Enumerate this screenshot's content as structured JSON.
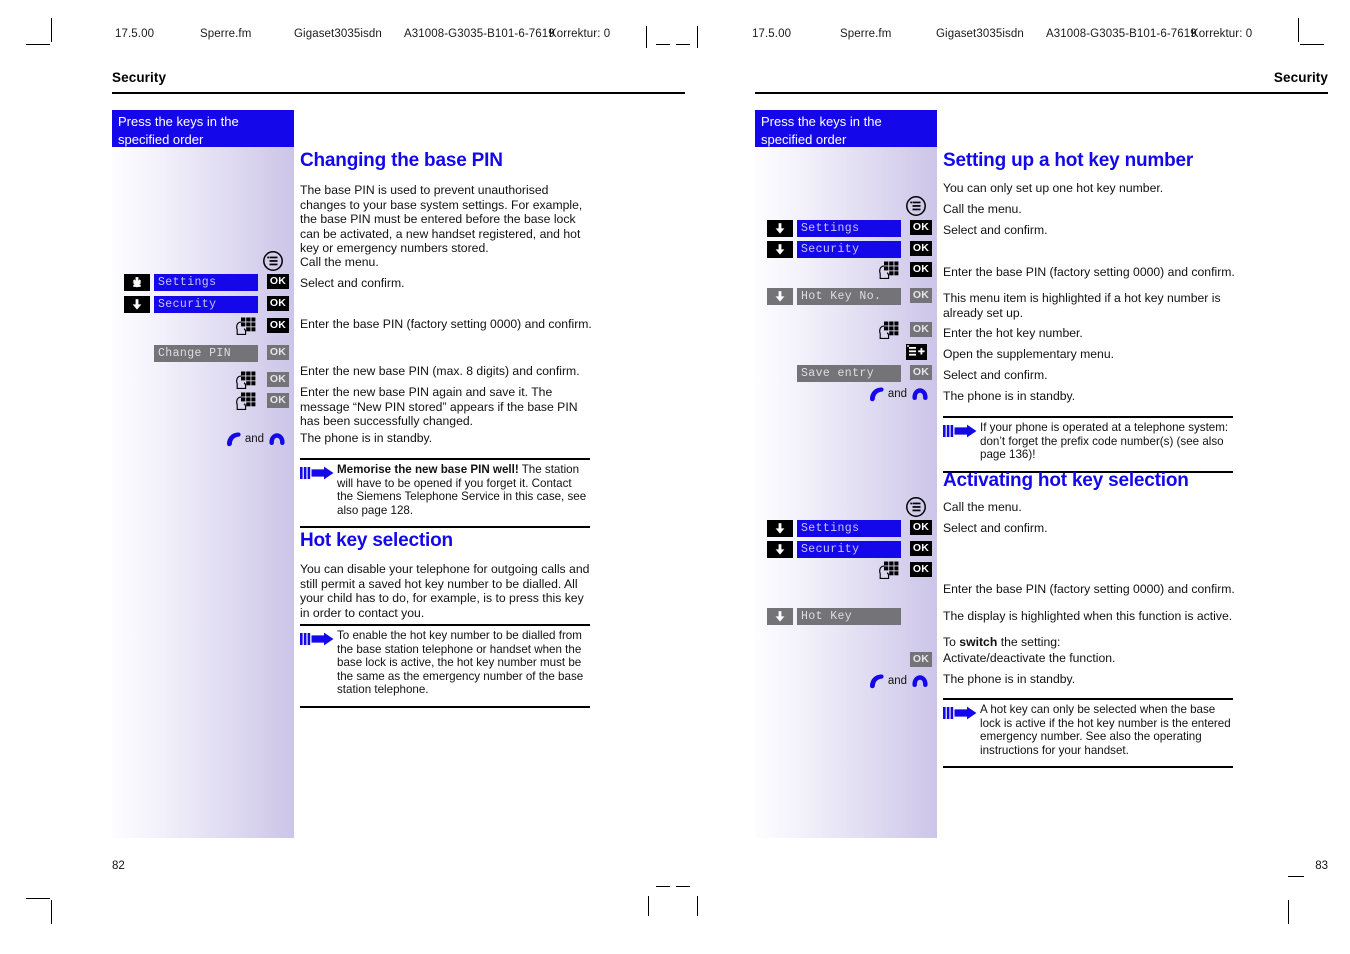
{
  "printer_marks": {
    "left": {
      "date": "17.5.00",
      "file": "Sperre.fm",
      "product": "Gigaset3035isdn",
      "docnum": "A31008-G3035-B101-6-7619",
      "correction": "Korrektur: 0"
    },
    "right": {
      "date": "17.5.00",
      "file": "Sperre.fm",
      "product": "Gigaset3035isdn",
      "docnum": "A31008-G3035-B101-6-7619",
      "correction": "Korrektur: 0"
    }
  },
  "left_page": {
    "running_head": "Security",
    "folio": "82",
    "keycol_header_line1": "Press the keys in the",
    "keycol_header_line2": "specified order",
    "steps": [
      {
        "icon": "menu-icon",
        "display": null,
        "ok": null,
        "arrow": false
      },
      {
        "icon": null,
        "display": "Settings",
        "display_state": "on",
        "ok": "OK",
        "ok_state": "on",
        "arrow": true,
        "arrow_state": "on"
      },
      {
        "icon": null,
        "display": "Security",
        "display_state": "on",
        "ok": "OK",
        "ok_state": "on",
        "arrow": true,
        "arrow_state": "on"
      },
      {
        "icon": "keypad-icon",
        "display": null,
        "ok": "OK",
        "ok_state": "on",
        "arrow": false
      },
      {
        "icon": null,
        "display": "Change PIN",
        "display_state": "off",
        "ok": "OK",
        "ok_state": "off",
        "arrow": false
      },
      {
        "icon": "keypad-icon",
        "display": null,
        "ok": "OK",
        "ok_state": "off",
        "arrow": false
      },
      {
        "icon": "keypad-icon",
        "display": null,
        "ok": "OK",
        "ok_state": "off",
        "arrow": false
      },
      {
        "icon": "hook-icons",
        "and_label": "and"
      }
    ],
    "and_label": "and",
    "section1": {
      "heading": "Changing the base PIN",
      "intro": "The base PIN is used to prevent unauthorised changes to your base system settings. For example, the base PIN must be entered before the base lock can be activated, a new handset registered, and hot key or emergency numbers stored.",
      "lines": [
        "Call the menu.",
        "Select and confirm.",
        "Enter the base PIN (factory setting 0000) and confirm.",
        "Enter the new base PIN (max. 8 digits) and confirm.",
        "Enter the new base PIN again and save it. The message “New PIN  stored” appears if the base PIN has been successfully changed.",
        "The phone is in standby."
      ],
      "note_bold": "Memorise the new base PIN well!",
      "note_rest": " The station will have to be opened if you forget it. Contact the Siemens Telephone Service in this case, see also page 128."
    },
    "section2": {
      "heading": "Hot key selection",
      "intro": "You can disable your telephone for outgoing calls and still permit a saved hot key number to be dialled. All your child has to do, for example, is to press this key in order to contact you.",
      "note": "To enable the hot key number to be dialled from the base station telephone or handset when the base lock is active, the hot key number must be the same as the emergency number of the base station telephone."
    }
  },
  "right_page": {
    "running_head": "Security",
    "folio": "83",
    "keycol_header_line1": "Press the keys in the",
    "keycol_header_line2": "specified order",
    "and_label": "and",
    "steps_a": [
      {
        "icon": "menu-icon"
      },
      {
        "display": "Settings",
        "display_state": "on",
        "ok": "OK",
        "ok_state": "on",
        "arrow": true,
        "arrow_state": "on"
      },
      {
        "display": "Security",
        "display_state": "on",
        "ok": "OK",
        "ok_state": "on",
        "arrow": true,
        "arrow_state": "on"
      },
      {
        "icon": "keypad-icon",
        "ok": "OK",
        "ok_state": "on"
      },
      {
        "display": "Hot Key No.",
        "display_state": "off",
        "ok": "OK",
        "ok_state": "off",
        "arrow": true,
        "arrow_state": "off"
      },
      {
        "icon": "keypad-icon",
        "ok": "OK",
        "ok_state": "off"
      },
      {
        "icon": "supplementary-menu-icon"
      },
      {
        "display": "Save entry",
        "display_state": "off",
        "ok": "OK",
        "ok_state": "off",
        "arrow": false
      },
      {
        "icon": "hook-icons"
      }
    ],
    "steps_b": [
      {
        "icon": "menu-icon"
      },
      {
        "display": "Settings",
        "display_state": "on",
        "ok": "OK",
        "ok_state": "on",
        "arrow": true,
        "arrow_state": "on"
      },
      {
        "display": "Security",
        "display_state": "on",
        "ok": "OK",
        "ok_state": "on",
        "arrow": true,
        "arrow_state": "on"
      },
      {
        "icon": "keypad-icon",
        "ok": "OK",
        "ok_state": "on"
      },
      {
        "display": "Hot Key",
        "display_state": "off",
        "arrow": true,
        "arrow_state": "off"
      },
      {
        "ok": "OK",
        "ok_state": "off"
      },
      {
        "icon": "hook-icons"
      }
    ],
    "section1": {
      "heading": "Setting up a hot key number",
      "intro": "You can only set up one hot key number.",
      "lines": [
        "Call the menu.",
        "Select and confirm.",
        "Enter the base PIN (factory setting 0000) and confirm.",
        "This menu item is highlighted if a hot key number is already set up.",
        "Enter the hot key number.",
        "Open the supplementary menu.",
        "Select and confirm.",
        "The phone is in standby."
      ],
      "note": "If your phone is operated at a telephone system: don’t forget the prefix code number(s) (see also page 136)!"
    },
    "section2": {
      "heading": "Activating hot key selection",
      "lines": [
        "Call the menu.",
        "Select and confirm.",
        "Enter the base PIN (factory setting 0000) and confirm.",
        "The display is highlighted when this function is active.",
        "Activate/deactivate the function.",
        "The phone is in standby."
      ],
      "switch_prefix": "To ",
      "switch_bold": "switch",
      "switch_suffix": " the setting:",
      "note": "A hot key can only be selected when the base lock is active if the hot key number is the entered emergency number. See also the operating instructions for your handset."
    }
  },
  "colors": {
    "accent_blue": "#1408ea",
    "dim_gray": "#737378",
    "display_text_on": "#c9c2f0",
    "display_text_off": "#dedee2"
  }
}
